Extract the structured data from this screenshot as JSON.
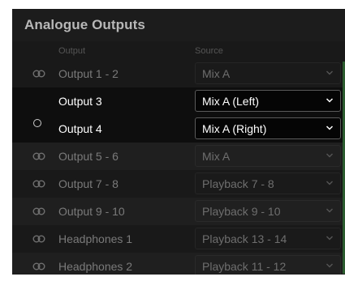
{
  "title": "Analogue Outputs",
  "headers": {
    "output": "Output",
    "source": "Source"
  },
  "rows": [
    {
      "label": "Output 1 - 2",
      "source": "Mix A",
      "stereo": true
    },
    {
      "label": "Output 3",
      "source": "Mix A (Left)",
      "stereo": false,
      "selected": true
    },
    {
      "label": "Output 4",
      "source": "Mix A (Right)",
      "stereo": false,
      "selected": true
    },
    {
      "label": "Output 5 - 6",
      "source": "Mix A",
      "stereo": true
    },
    {
      "label": "Output 7 - 8",
      "source": "Playback 7 - 8",
      "stereo": true
    },
    {
      "label": "Output 9 - 10",
      "source": "Playback 9 - 10",
      "stereo": true
    },
    {
      "label": "Headphones 1",
      "source": "Playback 13 - 14",
      "stereo": true
    },
    {
      "label": "Headphones 2",
      "source": "Playback 11 - 12",
      "stereo": true
    }
  ],
  "icons": {
    "stereo_link": "stereo-link-icon",
    "unlinked": "unlinked-circle-icon",
    "dropdown": "chevron-down-icon"
  },
  "colors": {
    "panel_bg": "#1c1c1c",
    "selected_bg": "#0e0e0e",
    "accent": "#2b5c2f"
  }
}
